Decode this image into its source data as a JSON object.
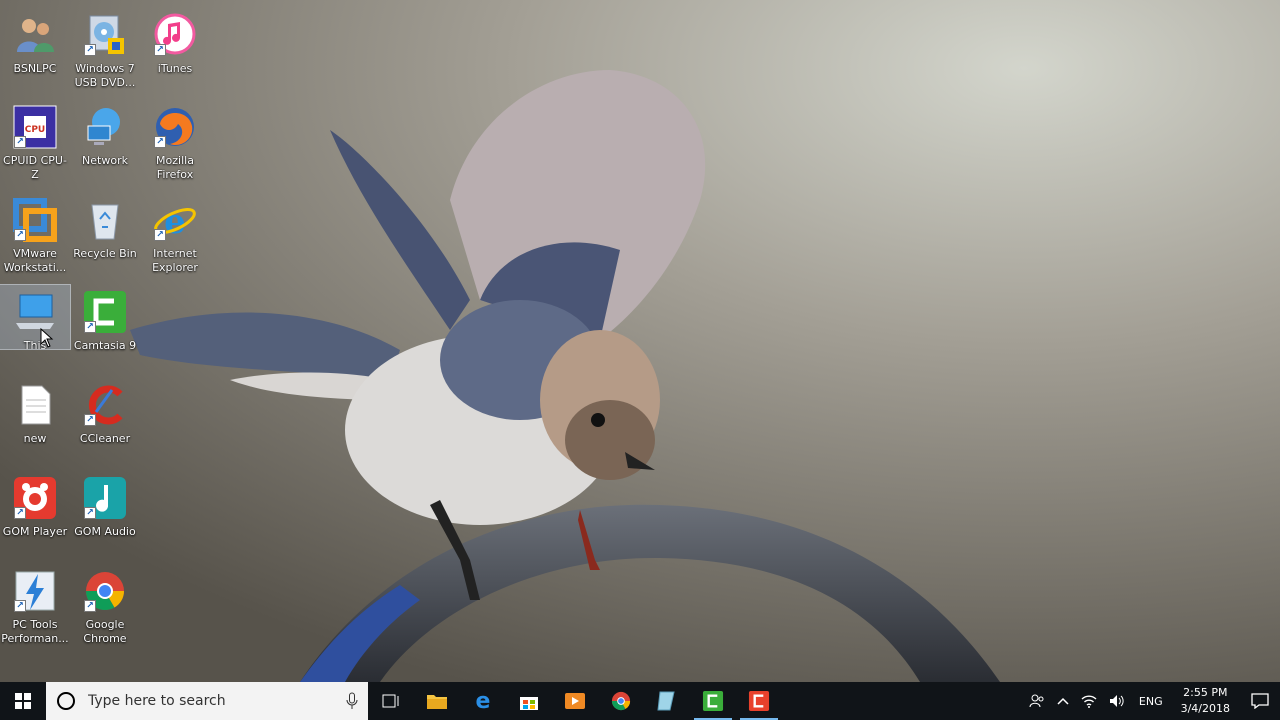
{
  "desktop": {
    "icons": [
      {
        "name": "BSNLPC",
        "icon": "user-folder-icon"
      },
      {
        "name": "Windows 7 USB DVD...",
        "icon": "usb-dvd-tool-icon"
      },
      {
        "name": "iTunes",
        "icon": "itunes-icon"
      },
      {
        "name": "CPUID CPU-Z",
        "icon": "cpu-z-icon"
      },
      {
        "name": "Network",
        "icon": "network-icon"
      },
      {
        "name": "Mozilla Firefox",
        "icon": "firefox-icon"
      },
      {
        "name": "VMware Workstati...",
        "icon": "vmware-icon"
      },
      {
        "name": "Recycle Bin",
        "icon": "recycle-bin-icon"
      },
      {
        "name": "Internet Explorer",
        "icon": "internet-explorer-icon"
      },
      {
        "name": "This",
        "icon": "this-pc-icon"
      },
      {
        "name": "Camtasia 9",
        "icon": "camtasia-icon"
      },
      {
        "name": "new",
        "icon": "text-document-icon"
      },
      {
        "name": "CCleaner",
        "icon": "ccleaner-icon"
      },
      {
        "name": "GOM Player",
        "icon": "gom-player-icon"
      },
      {
        "name": "GOM Audio",
        "icon": "gom-audio-icon"
      },
      {
        "name": "PC Tools Performan...",
        "icon": "pc-tools-icon"
      },
      {
        "name": "Google Chrome",
        "icon": "chrome-icon"
      }
    ]
  },
  "taskbar": {
    "search_placeholder": "Type here to search",
    "pinned": [
      "start-icon",
      "task-view-icon",
      "file-explorer-icon",
      "edge-icon",
      "store-icon",
      "media-player-icon",
      "chrome-icon",
      "notepad-icon",
      "camtasia-icon",
      "camtasia-recorder-icon"
    ],
    "tray": {
      "language": "ENG",
      "time": "2:55 PM",
      "date": "3/4/2018"
    }
  },
  "colors": {
    "taskbar_bg": "#101418",
    "accent": "#76b9ed"
  }
}
